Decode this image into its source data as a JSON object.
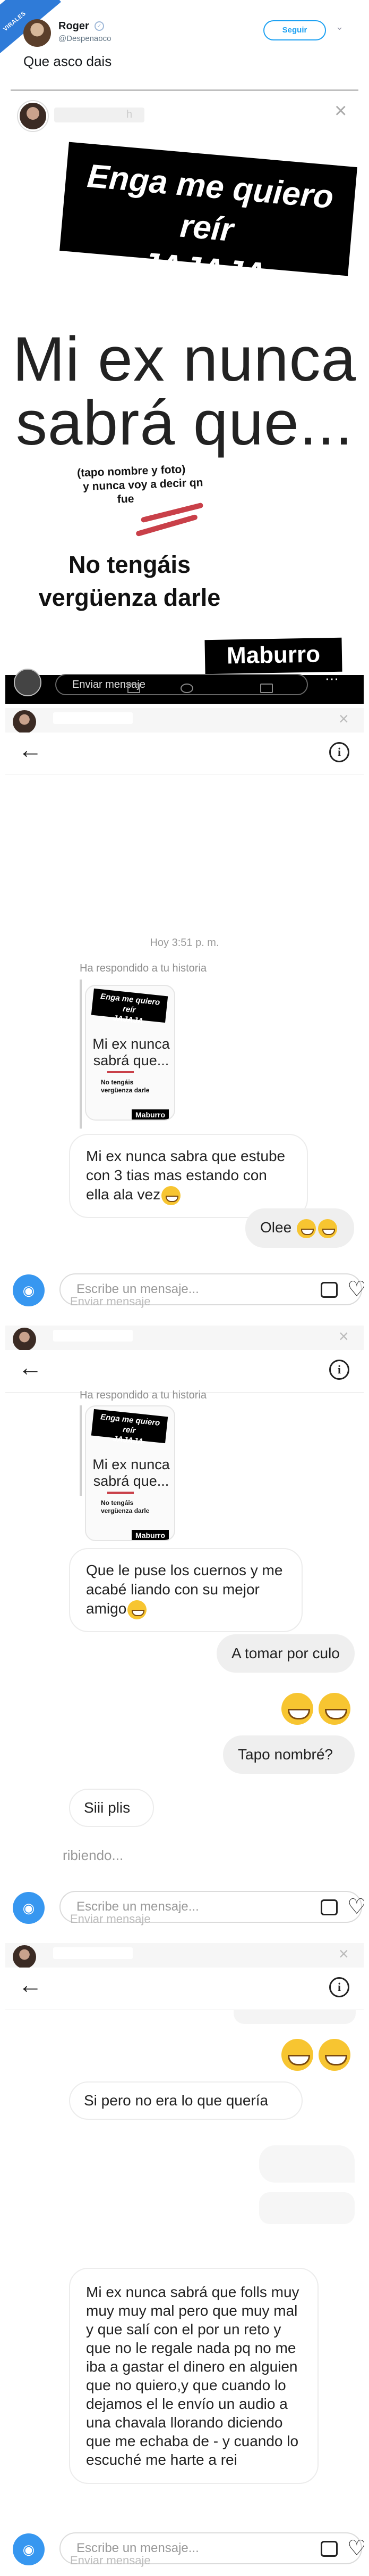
{
  "tweet": {
    "corner_label": "VIRALES",
    "name": "Roger",
    "handle": "@Despenaoco",
    "follow_label": "Seguir",
    "text": "Que asco dais"
  },
  "story": {
    "sticker_line1": "Enga me quiero reír",
    "sticker_line2": "JAJAJA",
    "headline_line1": "Mi ex nunca",
    "headline_line2": "sabrá que...",
    "note_line1": "(tapo nombre y foto)",
    "note_line2": "y nunca voy a decir qn",
    "note_line3": "fue",
    "cta_line1": "No tengáis",
    "cta_line2": "vergüenza darle",
    "signature": "Maburro",
    "input_placeholder": "Enviar mensaje",
    "faint_text": "Escribe un mensaje..."
  },
  "chat1": {
    "timestamp": "Hoy 3:51 p. m.",
    "reply_hint": "Ha respondido a tu historia",
    "msg_received": "Mi ex nunca sabra que estube con 3 tias mas estando con ella ala vez",
    "msg_sent": "Olee",
    "input_placeholder": "Enviar mensaje",
    "faint_text": "Escribe un mensaje..."
  },
  "chat2": {
    "reply_hint": "Ha respondido a tu historia",
    "msg_received_1": "Que le puse los cuernos y me acabé liando con su mejor amigo",
    "msg_sent_1": "A tomar por culo",
    "msg_sent_2": "Tapo nombré?",
    "msg_received_2": "Siii plis",
    "typing": "ribiendo...",
    "input_placeholder": "Enviar mensaje",
    "faint_text": "Escribe un mensaje..."
  },
  "chat3": {
    "msg_received_1": "Si pero no era lo que quería",
    "msg_received_2": "Mi ex nunca sabrá que folls muy muy muy mal pero que muy mal y que salí con el por un reto y que no le regale nada pq no me iba a gastar el dinero en alguien que no quiero,y que cuando lo dejamos el le envío un audio a una chavala llorando diciendo que me echaba de - y cuando lo escuché me harte a rei",
    "input_placeholder": "Enviar mensaje",
    "faint_text": "Escribe un mensaje..."
  },
  "icons": [
    "verified-icon",
    "chevron-down-icon",
    "close-icon",
    "camera-icon",
    "more-icon",
    "back-arrow-icon",
    "info-icon",
    "image-icon",
    "heart-icon",
    "grinning-emoji-icon"
  ],
  "colors": {
    "twitter_blue": "#1da1f2",
    "instagram_blue": "#3797f0",
    "sticker_black": "#000000",
    "scribble_red": "#c94049"
  }
}
